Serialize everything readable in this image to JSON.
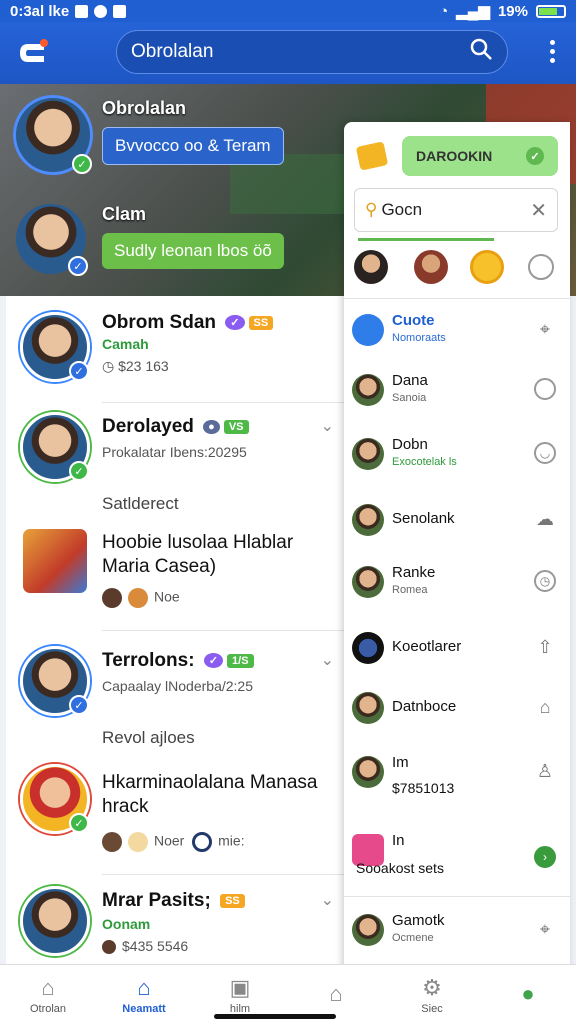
{
  "status_bar": {
    "time": "0:3al lke",
    "battery": "19%"
  },
  "app_bar": {
    "search_text": "Obrolalan"
  },
  "hero": {
    "user1": {
      "name": "Obrolalan",
      "bubble": "Bvvocco oo & Teram"
    },
    "user2": {
      "name": "Clam",
      "bubble": "Sudly leonan lbos öõ"
    }
  },
  "chats": [
    {
      "title": "Obrom Sdan",
      "badge": "SS",
      "sub1": "Camah",
      "sub2": "$23 163"
    },
    {
      "title": "Derolayed",
      "badge": "VS",
      "sub1": "Prokalatar Ibens:20295"
    },
    {
      "section": "Satlderect",
      "title_l1": "Hoobie lusolaa Hlablar",
      "title_l2": "Maria Casea)",
      "sub1": "Noe"
    },
    {
      "title": "Terrolons:",
      "badge": "1/S",
      "sub1": "Capaalay lNoderba/2:25"
    },
    {
      "section": "Revol ajloes",
      "title_l1": "Hkarminaolalana Manasa",
      "title_l2": "hrack",
      "sub1": "Noer",
      "sub2": "mie:"
    },
    {
      "title": "Mrar Pasits;",
      "badge": "SS",
      "sub1": "Oonam",
      "sub2": "$435 5546"
    }
  ],
  "panel": {
    "button": "DAROOKIN",
    "search": "Gocn",
    "items": [
      {
        "name": "Cuote",
        "sub": "Nomoraats"
      },
      {
        "name": "Dana",
        "sub": "Sanoia"
      },
      {
        "name": "Dobn",
        "sub": "Exocotelak ls"
      },
      {
        "name": "Senolank",
        "sub": ""
      },
      {
        "name": "Ranke",
        "sub": "Romea"
      },
      {
        "name": "Koeotlarer",
        "sub": ""
      },
      {
        "name": "Datnboce",
        "sub": ""
      },
      {
        "name": "Im",
        "sub": "$7851013"
      },
      {
        "name": "In",
        "sub": "Sooakost sets"
      },
      {
        "name": "Gamotk",
        "sub": "Ocmene"
      }
    ]
  },
  "bottom_nav": [
    {
      "label": "Otrolan",
      "icon": "home-alert-icon"
    },
    {
      "label": "Neamatt",
      "icon": "home-icon"
    },
    {
      "label": "hilm",
      "icon": "media-icon"
    },
    {
      "label": "",
      "icon": "profile-home-icon"
    },
    {
      "label": "Siec",
      "icon": "settings-icon"
    },
    {
      "label": "",
      "icon": "user-icon"
    }
  ]
}
